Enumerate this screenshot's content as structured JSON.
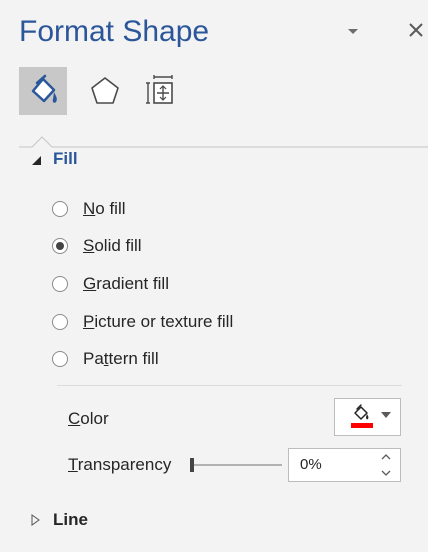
{
  "pane": {
    "title": "Format Shape"
  },
  "tabs": [
    {
      "icon": "fill-line-icon",
      "selected": true
    },
    {
      "icon": "effects-pentagon-icon",
      "selected": false
    },
    {
      "icon": "size-properties-icon",
      "selected": false
    }
  ],
  "fill_section": {
    "label": "Fill",
    "expanded": true,
    "options": [
      {
        "prefix": "",
        "accel": "N",
        "rest": "o fill",
        "selected": false
      },
      {
        "prefix": "",
        "accel": "S",
        "rest": "olid fill",
        "selected": true
      },
      {
        "prefix": "",
        "accel": "G",
        "rest": "radient fill",
        "selected": false
      },
      {
        "prefix": "",
        "accel": "P",
        "rest": "icture or texture fill",
        "selected": false
      },
      {
        "prefix": "Pa",
        "accel": "t",
        "rest": "tern fill",
        "selected": false
      }
    ],
    "color": {
      "accel": "C",
      "rest": "olor",
      "swatch": "#ff0000"
    },
    "transparency": {
      "accel": "T",
      "rest": "ransparency",
      "value_text": "0%",
      "value": 0
    }
  },
  "line_section": {
    "label": "Line",
    "expanded": false
  },
  "colors": {
    "accent": "#2b579a",
    "pane_bg": "#f3f3f3",
    "tab_selected_bg": "#c8c8c8"
  }
}
